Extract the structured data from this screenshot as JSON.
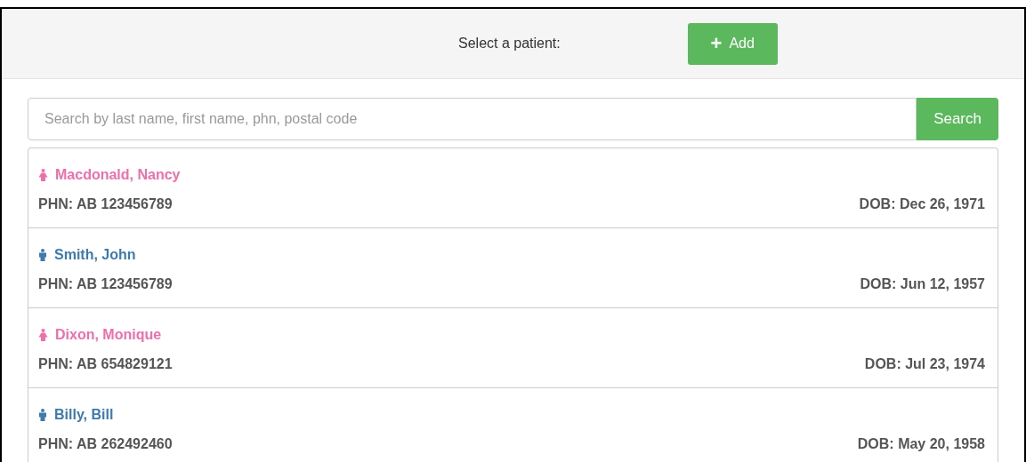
{
  "header": {
    "prompt": "Select a patient:",
    "add_button": {
      "icon": "+",
      "label": "Add"
    }
  },
  "search": {
    "placeholder": "Search by last name, first name, phn, postal code",
    "button": "Search"
  },
  "patients": [
    {
      "kind": "female",
      "color": "#f06eaa",
      "name": "Macdonald, Nancy",
      "phn": "PHN: AB 123456789",
      "dob": "DOB: Dec 26, 1971"
    },
    {
      "kind": "male",
      "color": "#3b7bb0",
      "name": "Smith, John",
      "phn": "PHN: AB 123456789",
      "dob": "DOB: Jun 12, 1957"
    },
    {
      "kind": "female",
      "color": "#f06eaa",
      "name": "Dixon, Monique",
      "phn": "PHN: AB 654829121",
      "dob": "DOB: Jul 23, 1974"
    },
    {
      "kind": "male",
      "color": "#3b7bb0",
      "name": "Billy, Bill",
      "phn": "PHN: AB 262492460",
      "dob": "DOB: May 20, 1958"
    }
  ]
}
